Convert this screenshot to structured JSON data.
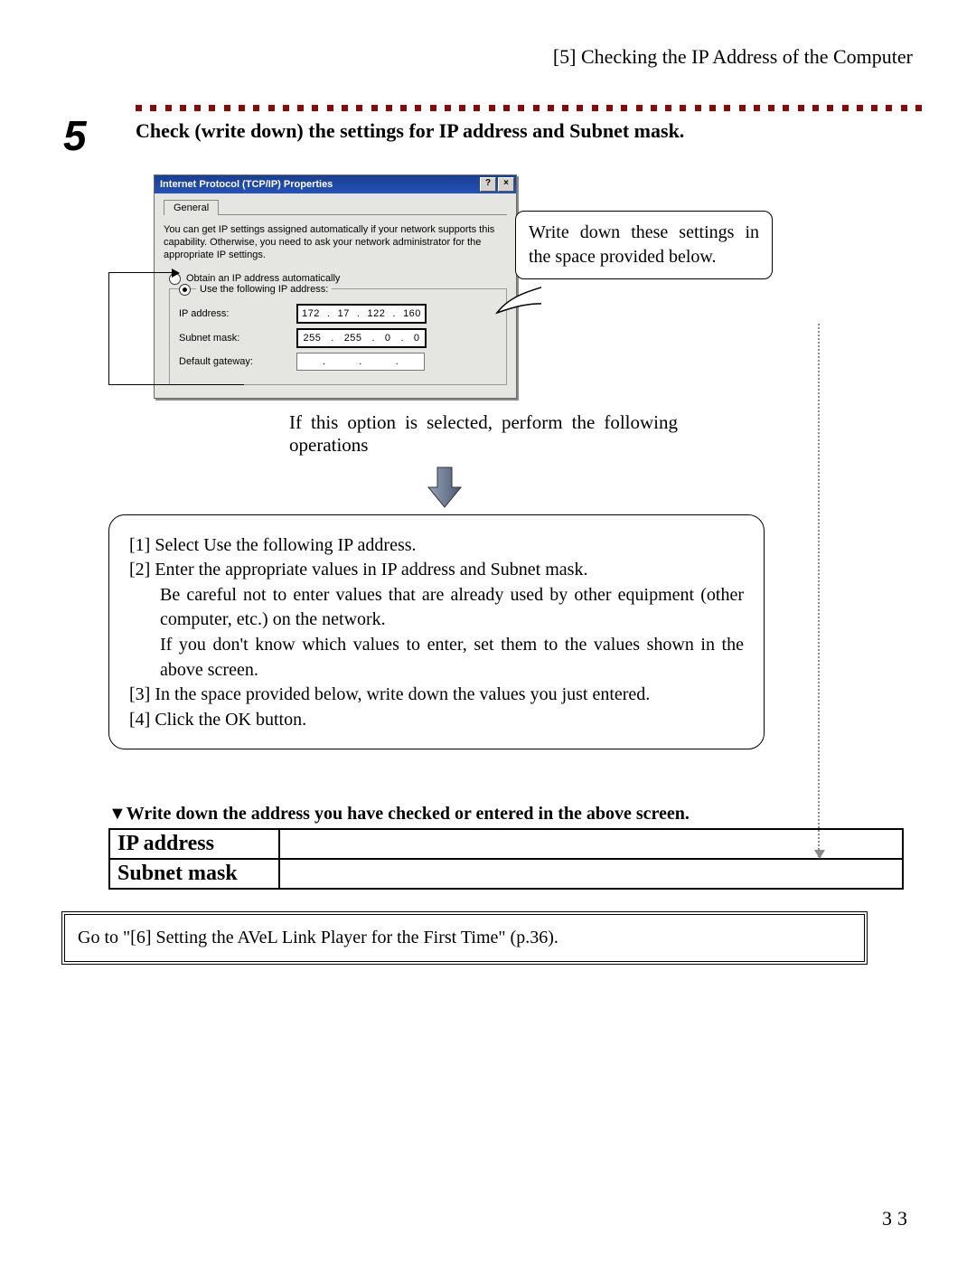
{
  "header": "[5] Checking the IP Address of the Computer",
  "step_number": "5",
  "step_title": "Check (write down) the settings for IP address and Subnet mask.",
  "dialog": {
    "title": "Internet Protocol (TCP/IP) Properties",
    "help_btn": "?",
    "close_btn": "×",
    "tab": "General",
    "description": "You can get IP settings assigned automatically if your network supports this capability. Otherwise, you need to ask your network administrator for the appropriate IP settings.",
    "radio_auto": "Obtain an IP address automatically",
    "radio_manual_legend": "Use the following IP address:",
    "labels": {
      "ip": "IP address:",
      "subnet": "Subnet mask:",
      "gateway": "Default gateway:"
    },
    "values": {
      "ip": [
        "172",
        "17",
        "122",
        "160"
      ],
      "subnet": [
        "255",
        "255",
        "0",
        "0"
      ],
      "gateway": [
        "",
        "",
        "",
        ""
      ]
    }
  },
  "callout": "Write down these settings in the space provided below.",
  "below_text": "If this option is selected, perform the following operations",
  "ops": {
    "l1": "[1] Select Use the following IP address.",
    "l2": "[2] Enter the appropriate values in IP address and Subnet mask.",
    "l2a": "Be careful not to enter values that are already used by other equipment (other computer, etc.) on the network.",
    "l2b": "If you don't know which values to enter, set them to the values shown in the above screen.",
    "l3": "[3] In the space provided below, write down the values you just entered.",
    "l4": "[4] Click the OK button."
  },
  "note": "▼Write down the address you have checked or entered in the above screen.",
  "table": {
    "row1": "IP address",
    "row2": "Subnet mask"
  },
  "goto": "Go to \"[6] Setting the AVeL Link Player for the First Time\" (p.36).",
  "page_num": "33"
}
